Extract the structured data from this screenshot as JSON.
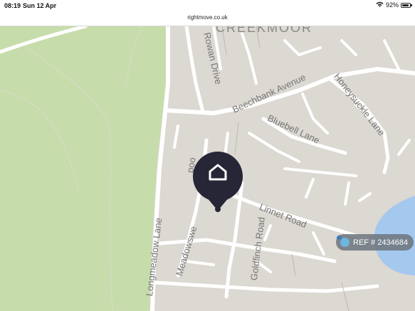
{
  "status_bar": {
    "time": "08:19",
    "date": "Sun 12 Apr",
    "battery": "92%",
    "battery_level": 0.92,
    "icons": [
      "wifi-icon",
      "battery-icon"
    ]
  },
  "browser": {
    "url": "rightmove.co.uk"
  },
  "map": {
    "area_label": "CREEKMOOR",
    "streets": {
      "rowan": "Rowan Drive",
      "beechbank": "Beechbank Avenue",
      "honeysuckle": "Honeysuckle Lane",
      "bluebell": "Bluebell Lane",
      "longmeadow": "Longmeadow Lane",
      "meadowsweet": "Meadowswe",
      "meadowsweet_top": "ood",
      "goldfinch": "Goldfinch Road",
      "linnet": "Linnet Road"
    },
    "colors": {
      "park": "#c7dcab",
      "land": "#dcd8d2",
      "road": "#ffffff",
      "water": "#a5c8ee",
      "pin": "#262637"
    },
    "marker_icon": "home-icon"
  },
  "ref_badge": {
    "icon": "home-icon",
    "text": "REF # 2434684"
  }
}
